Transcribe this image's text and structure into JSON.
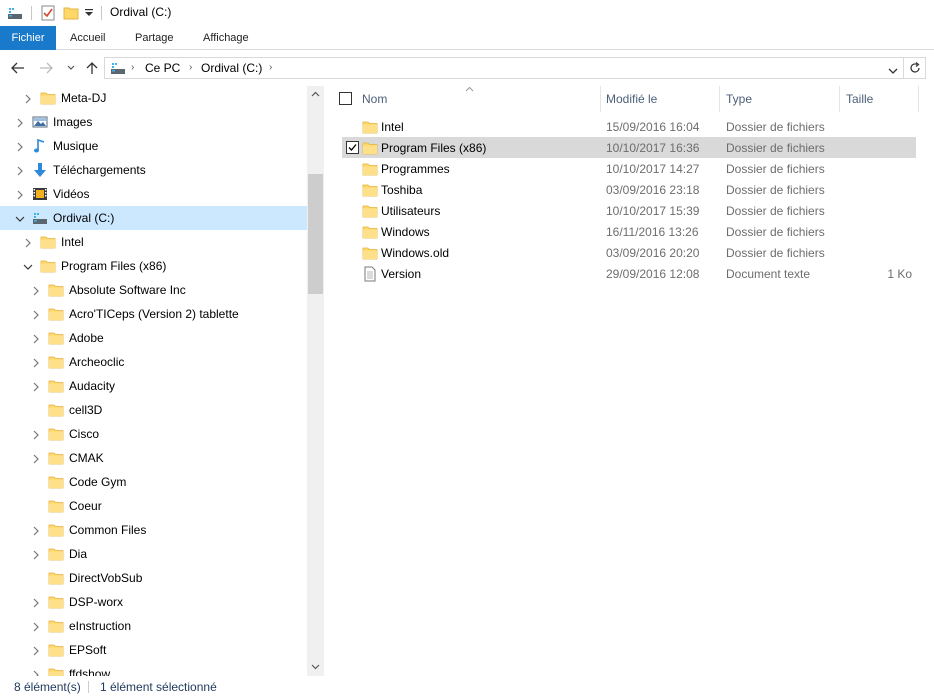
{
  "window": {
    "title": "Ordival (C:)"
  },
  "ribbon": {
    "tabs": [
      "Fichier",
      "Accueil",
      "Partage",
      "Affichage"
    ]
  },
  "address": {
    "crumbs": [
      "Ce PC",
      "Ordival (C:)"
    ]
  },
  "tree": [
    {
      "label": "Meta-DJ",
      "icon": "folder-icon",
      "expander": "collapsed",
      "level": 1
    },
    {
      "label": "Images",
      "icon": "pictures-icon",
      "expander": "collapsed",
      "level": 0
    },
    {
      "label": "Musique",
      "icon": "music-icon",
      "expander": "collapsed",
      "level": 0
    },
    {
      "label": "Téléchargements",
      "icon": "downloads-icon",
      "expander": "collapsed",
      "level": 0
    },
    {
      "label": "Vidéos",
      "icon": "videos-icon",
      "expander": "collapsed",
      "level": 0
    },
    {
      "label": "Ordival (C:)",
      "icon": "drive-icon",
      "expander": "expanded",
      "level": 0,
      "selected": true
    },
    {
      "label": "Intel",
      "icon": "folder-icon",
      "expander": "collapsed",
      "level": 1
    },
    {
      "label": "Program Files (x86)",
      "icon": "folder-icon",
      "expander": "expanded",
      "level": 1
    },
    {
      "label": "Absolute Software Inc",
      "icon": "folder-icon",
      "expander": "collapsed",
      "level": 2
    },
    {
      "label": "Acro'TICeps (Version 2) tablette",
      "icon": "folder-icon",
      "expander": "collapsed",
      "level": 2
    },
    {
      "label": "Adobe",
      "icon": "folder-icon",
      "expander": "collapsed",
      "level": 2
    },
    {
      "label": "Archeoclic",
      "icon": "folder-icon",
      "expander": "collapsed",
      "level": 2
    },
    {
      "label": "Audacity",
      "icon": "folder-icon",
      "expander": "collapsed",
      "level": 2
    },
    {
      "label": "cell3D",
      "icon": "folder-icon",
      "expander": "none",
      "level": 2
    },
    {
      "label": "Cisco",
      "icon": "folder-icon",
      "expander": "collapsed",
      "level": 2
    },
    {
      "label": "CMAK",
      "icon": "folder-icon",
      "expander": "collapsed",
      "level": 2
    },
    {
      "label": "Code Gym",
      "icon": "folder-icon",
      "expander": "none",
      "level": 2
    },
    {
      "label": "Coeur",
      "icon": "folder-icon",
      "expander": "none",
      "level": 2
    },
    {
      "label": "Common Files",
      "icon": "folder-icon",
      "expander": "collapsed",
      "level": 2
    },
    {
      "label": "Dia",
      "icon": "folder-icon",
      "expander": "collapsed",
      "level": 2
    },
    {
      "label": "DirectVobSub",
      "icon": "folder-icon",
      "expander": "none",
      "level": 2
    },
    {
      "label": "DSP-worx",
      "icon": "folder-icon",
      "expander": "collapsed",
      "level": 2
    },
    {
      "label": "eInstruction",
      "icon": "folder-icon",
      "expander": "collapsed",
      "level": 2
    },
    {
      "label": "EPSoft",
      "icon": "folder-icon",
      "expander": "collapsed",
      "level": 2
    },
    {
      "label": "ffdshow",
      "icon": "folder-icon",
      "expander": "collapsed",
      "level": 2
    }
  ],
  "columns": {
    "name": "Nom",
    "date": "Modifié le",
    "type": "Type",
    "size": "Taille"
  },
  "files": [
    {
      "name": "Intel",
      "date": "15/09/2016 16:04",
      "type": "Dossier de fichiers",
      "size": "",
      "icon": "folder-icon"
    },
    {
      "name": "Program Files (x86)",
      "date": "10/10/2017 16:36",
      "type": "Dossier de fichiers",
      "size": "",
      "icon": "folder-icon",
      "selected": true
    },
    {
      "name": "Programmes",
      "date": "10/10/2017 14:27",
      "type": "Dossier de fichiers",
      "size": "",
      "icon": "folder-icon"
    },
    {
      "name": "Toshiba",
      "date": "03/09/2016 23:18",
      "type": "Dossier de fichiers",
      "size": "",
      "icon": "folder-icon"
    },
    {
      "name": "Utilisateurs",
      "date": "10/10/2017 15:39",
      "type": "Dossier de fichiers",
      "size": "",
      "icon": "folder-icon"
    },
    {
      "name": "Windows",
      "date": "16/11/2016 13:26",
      "type": "Dossier de fichiers",
      "size": "",
      "icon": "folder-icon"
    },
    {
      "name": "Windows.old",
      "date": "03/09/2016 20:20",
      "type": "Dossier de fichiers",
      "size": "",
      "icon": "folder-icon"
    },
    {
      "name": "Version",
      "date": "29/09/2016 12:08",
      "type": "Document texte",
      "size": "1 Ko",
      "icon": "text-file-icon"
    }
  ],
  "status": {
    "count": "8 élément(s)",
    "selection": "1 élément sélectionné"
  },
  "colors": {
    "accent": "#1979ca",
    "tree_selected": "#cce8ff",
    "row_selected": "#d9d9d9",
    "folder": "#ffd767"
  }
}
